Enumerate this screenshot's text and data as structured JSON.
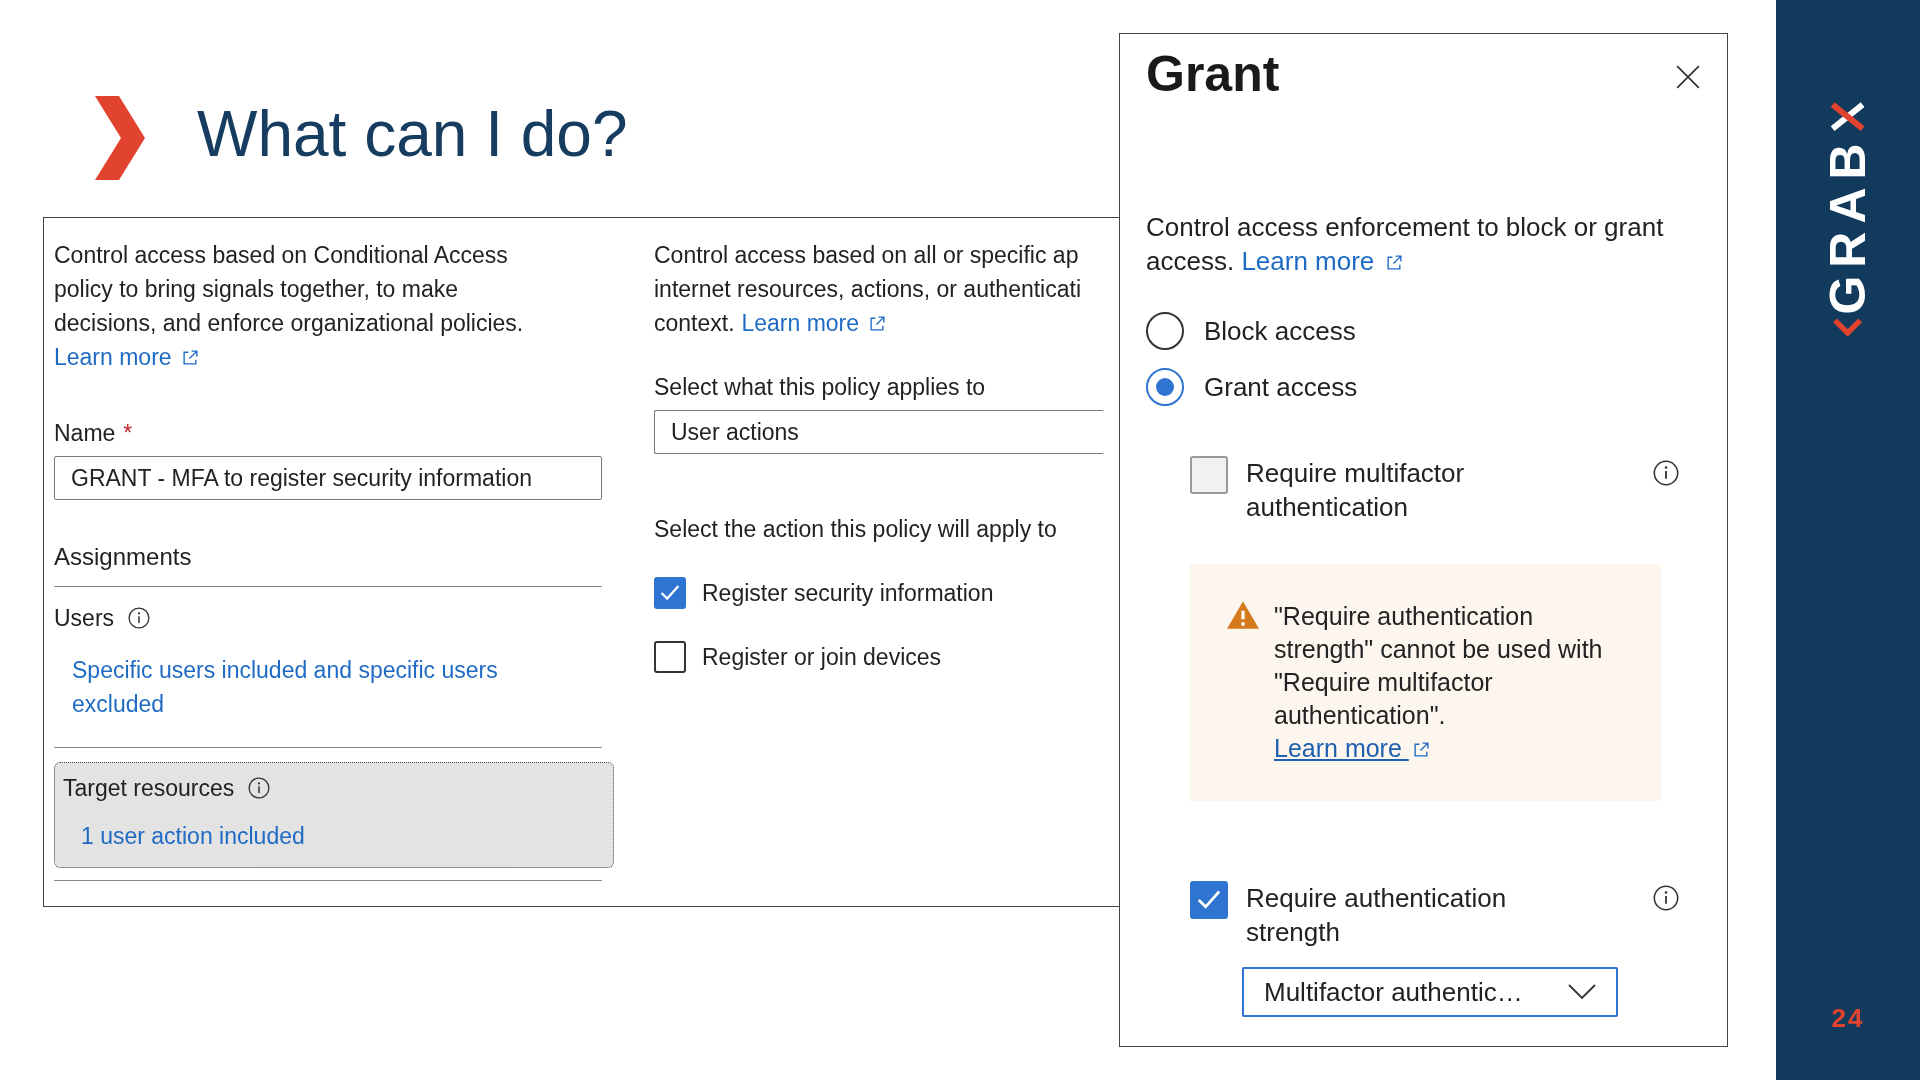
{
  "slide": {
    "title": "What can I do?",
    "logo_text": "GRAB",
    "page_number": "24"
  },
  "policy": {
    "description": "Control access based on Conditional Access policy to bring signals together, to make decisions, and enforce organizational policies.",
    "description_link": "Learn more",
    "name_label": "Name",
    "required_mark": "*",
    "name_value": "GRANT - MFA to register security information",
    "assignments_heading": "Assignments",
    "users_label": "Users",
    "users_value": "Specific users included and specific users excluded",
    "target_label": "Target resources",
    "target_value": "1 user action included",
    "target_selected": true,
    "resources_lines": [
      "Control access based on all or specific ap",
      "internet resources, actions, or authenticati",
      "context."
    ],
    "resources_link": "Learn more",
    "applies_label": "Select what this policy applies to",
    "applies_value": "User actions",
    "action_label": "Select the action this policy will apply to",
    "actions": [
      {
        "label": "Register security information",
        "checked": true
      },
      {
        "label": "Register or join devices",
        "checked": false
      }
    ]
  },
  "grant": {
    "title": "Grant",
    "description": "Control access enforcement to block or grant access.",
    "link": "Learn more",
    "options": [
      {
        "label": "Block access",
        "selected": false
      },
      {
        "label": "Grant access",
        "selected": true
      }
    ],
    "controls": [
      {
        "kind": "checkbox",
        "label": "Require multifactor authentication",
        "checked": false
      },
      {
        "kind": "warning",
        "text": "\"Require authentication strength\" cannot be used with \"Require multifactor authentication\".",
        "link": "Learn more"
      },
      {
        "kind": "checkbox",
        "label": "Require authentication strength",
        "checked": true,
        "dropdown": "Multifactor authentic…"
      }
    ]
  }
}
